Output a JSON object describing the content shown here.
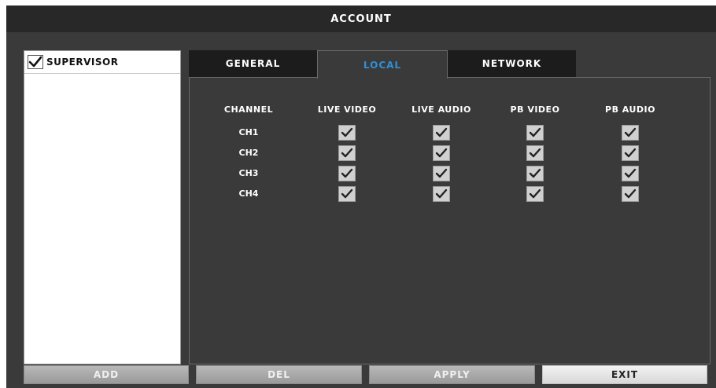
{
  "window": {
    "title": "ACCOUNT"
  },
  "users": [
    {
      "name": "SUPERVISOR",
      "checked": true
    }
  ],
  "tabs": [
    {
      "label": "GENERAL",
      "active": false
    },
    {
      "label": "LOCAL",
      "active": true
    },
    {
      "label": "NETWORK",
      "active": false
    }
  ],
  "table": {
    "headers": [
      "CHANNEL",
      "LIVE VIDEO",
      "LIVE AUDIO",
      "PB VIDEO",
      "PB AUDIO"
    ],
    "rows": [
      {
        "channel": "CH1",
        "live_video": true,
        "live_audio": true,
        "pb_video": true,
        "pb_audio": true
      },
      {
        "channel": "CH2",
        "live_video": true,
        "live_audio": true,
        "pb_video": true,
        "pb_audio": true
      },
      {
        "channel": "CH3",
        "live_video": true,
        "live_audio": true,
        "pb_video": true,
        "pb_audio": true
      },
      {
        "channel": "CH4",
        "live_video": true,
        "live_audio": true,
        "pb_video": true,
        "pb_audio": true
      }
    ]
  },
  "buttons": {
    "add": "ADD",
    "del": "DEL",
    "apply": "APPLY",
    "exit": "EXIT"
  },
  "colors": {
    "active_tab_text": "#2f8fd8",
    "panel_bg": "#3a3a3a",
    "title_bg": "#282828"
  }
}
